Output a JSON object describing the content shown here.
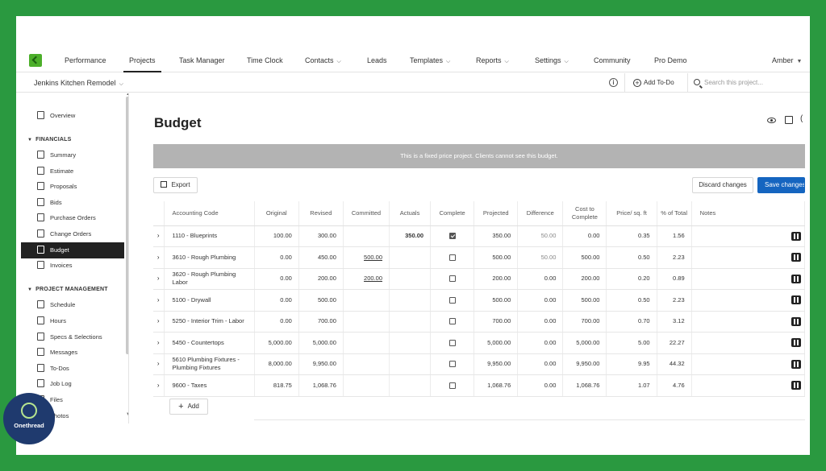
{
  "nav": {
    "items": [
      {
        "label": "Performance",
        "caret": false
      },
      {
        "label": "Projects",
        "caret": false,
        "active": true
      },
      {
        "label": "Task Manager",
        "caret": false
      },
      {
        "label": "Time Clock",
        "caret": false
      },
      {
        "label": "Contacts",
        "caret": true
      },
      {
        "label": "Leads",
        "caret": false
      },
      {
        "label": "Templates",
        "caret": true
      },
      {
        "label": "Reports",
        "caret": true
      },
      {
        "label": "Settings",
        "caret": true
      },
      {
        "label": "Community",
        "caret": false
      },
      {
        "label": "Pro Demo",
        "caret": false
      }
    ],
    "user": "Amber"
  },
  "subheader": {
    "project": "Jenkins Kitchen Remodel",
    "add_todo": "Add To-Do",
    "search_placeholder": "Search this project..."
  },
  "sidebar": {
    "overview": "Overview",
    "financials_header": "FINANCIALS",
    "financials": [
      "Summary",
      "Estimate",
      "Proposals",
      "Bids",
      "Purchase Orders",
      "Change Orders",
      "Budget",
      "Invoices"
    ],
    "pm_header": "PROJECT MANAGEMENT",
    "pm": [
      "Schedule",
      "Hours",
      "Specs & Selections",
      "Messages",
      "To-Dos",
      "Job Log",
      "Files",
      "Photos"
    ]
  },
  "badge": {
    "label": "Onethread"
  },
  "main": {
    "title": "Budget",
    "banner": "This is a fixed price project. Clients cannot see this budget.",
    "export": "Export",
    "discard": "Discard changes",
    "save": "Save changes",
    "add": "Add"
  },
  "table": {
    "headers": [
      "Accounting Code",
      "Original",
      "Revised",
      "Committed",
      "Actuals",
      "Complete",
      "Projected",
      "Difference",
      "Cost to Complete",
      "Price/ sq. ft",
      "% of Total",
      "Notes"
    ],
    "rows": [
      {
        "code": "1110 - Blueprints",
        "original": "100.00",
        "revised": "300.00",
        "committed": "",
        "actuals": "350.00",
        "complete": true,
        "projected": "350.00",
        "difference": "50.00",
        "cost_to_complete": "0.00",
        "price_sqft": "0.35",
        "pct_total": "1.56"
      },
      {
        "code": "3610 - Rough Plumbing",
        "original": "0.00",
        "revised": "450.00",
        "committed": "500.00",
        "actuals": "",
        "complete": false,
        "projected": "500.00",
        "difference": "50.00",
        "cost_to_complete": "500.00",
        "price_sqft": "0.50",
        "pct_total": "2.23"
      },
      {
        "code": "3620 - Rough Plumbing Labor",
        "original": "0.00",
        "revised": "200.00",
        "committed": "200.00",
        "actuals": "",
        "complete": false,
        "projected": "200.00",
        "difference": "0.00",
        "cost_to_complete": "200.00",
        "price_sqft": "0.20",
        "pct_total": "0.89"
      },
      {
        "code": "5100 - Drywall",
        "original": "0.00",
        "revised": "500.00",
        "committed": "",
        "actuals": "",
        "complete": false,
        "projected": "500.00",
        "difference": "0.00",
        "cost_to_complete": "500.00",
        "price_sqft": "0.50",
        "pct_total": "2.23"
      },
      {
        "code": "5250 - Interior Trim - Labor",
        "original": "0.00",
        "revised": "700.00",
        "committed": "",
        "actuals": "",
        "complete": false,
        "projected": "700.00",
        "difference": "0.00",
        "cost_to_complete": "700.00",
        "price_sqft": "0.70",
        "pct_total": "3.12"
      },
      {
        "code": "5450 - Countertops",
        "original": "5,000.00",
        "revised": "5,000.00",
        "committed": "",
        "actuals": "",
        "complete": false,
        "projected": "5,000.00",
        "difference": "0.00",
        "cost_to_complete": "5,000.00",
        "price_sqft": "5.00",
        "pct_total": "22.27"
      },
      {
        "code": "5610 Plumbing Fixtures - Plumbing Fixtures",
        "original": "8,000.00",
        "revised": "9,950.00",
        "committed": "",
        "actuals": "",
        "complete": false,
        "projected": "9,950.00",
        "difference": "0.00",
        "cost_to_complete": "9,950.00",
        "price_sqft": "9.95",
        "pct_total": "44.32"
      },
      {
        "code": "9600 - Taxes",
        "original": "818.75",
        "revised": "1,068.76",
        "committed": "",
        "actuals": "",
        "complete": false,
        "projected": "1,068.76",
        "difference": "0.00",
        "cost_to_complete": "1,068.76",
        "price_sqft": "1.07",
        "pct_total": "4.76"
      }
    ]
  }
}
